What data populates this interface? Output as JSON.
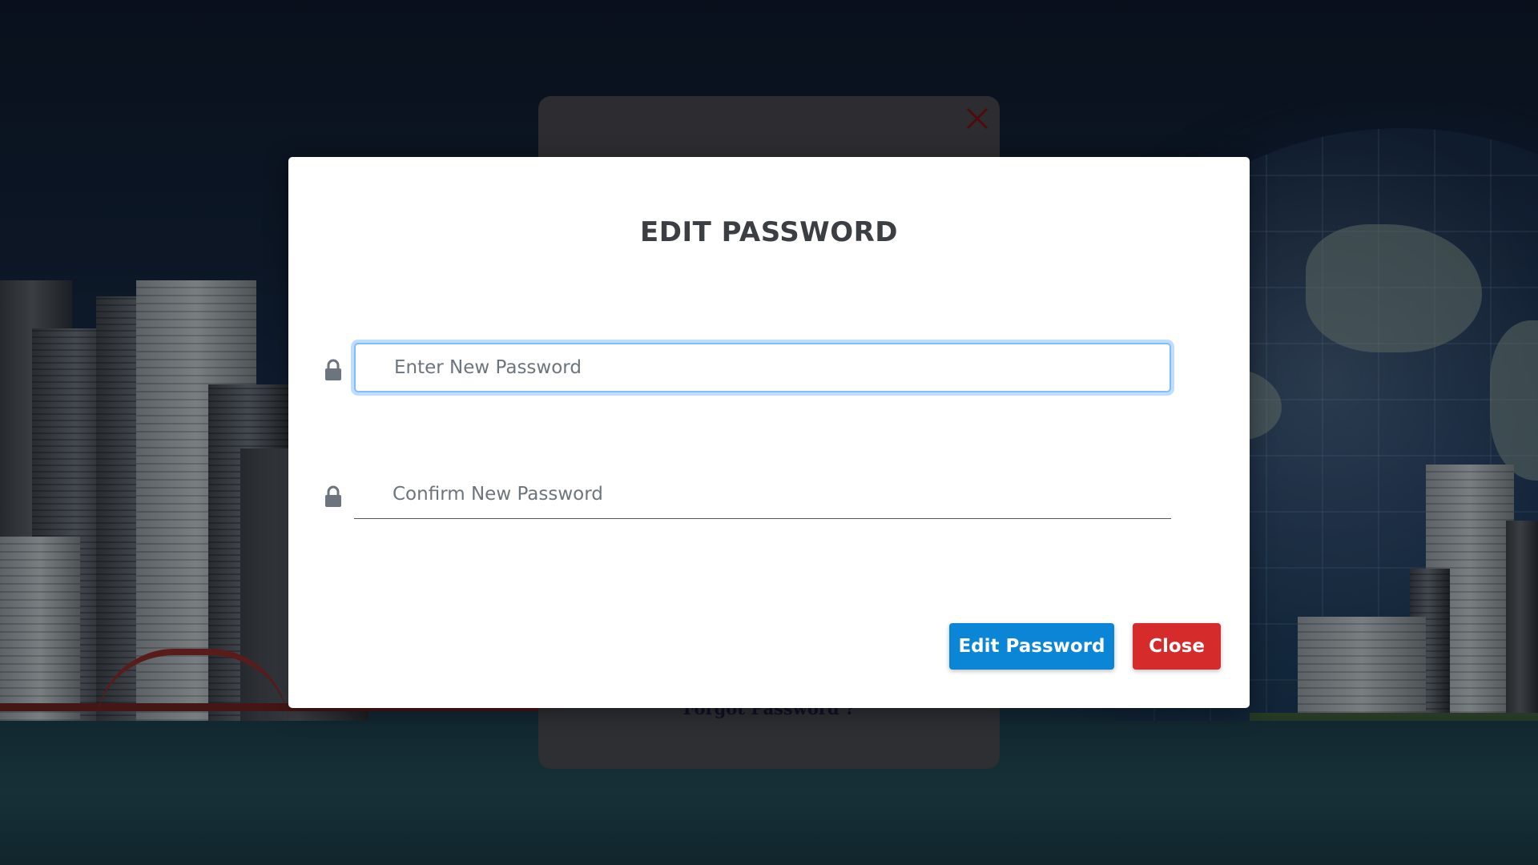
{
  "modal": {
    "title": "EDIT PASSWORD",
    "new_password": {
      "placeholder": "Enter New Password",
      "value": "",
      "icon": "lock-icon"
    },
    "confirm_password": {
      "placeholder": "Confirm New Password",
      "value": "",
      "icon": "lock-icon"
    },
    "primary_button_label": "Edit Password",
    "close_button_label": "Close"
  },
  "background_panel": {
    "close_icon": "close-icon",
    "forgot_link": "Forgot Password ?"
  },
  "colors": {
    "primary": "#0b86d6",
    "danger": "#d62b2b",
    "title": "#3b3f44",
    "focus_ring": "#80bdff"
  }
}
